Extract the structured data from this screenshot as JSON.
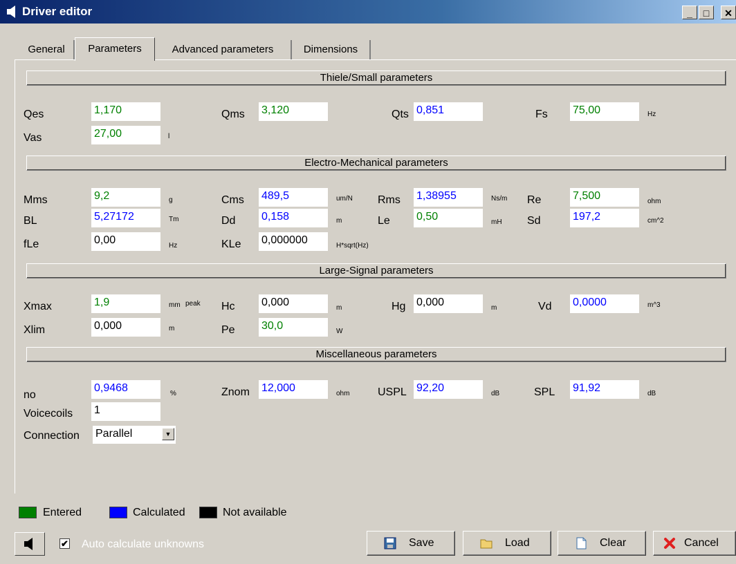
{
  "window": {
    "title": "Driver editor"
  },
  "tabs": [
    "General",
    "Parameters",
    "Advanced parameters",
    "Dimensions"
  ],
  "sections": {
    "ts": "Thiele/Small parameters",
    "em": "Electro-Mechanical parameters",
    "ls": "Large-Signal parameters",
    "misc": "Miscellaneous parameters"
  },
  "params": {
    "qes": {
      "label": "Qes",
      "value": "1,170",
      "unit": ""
    },
    "qms": {
      "label": "Qms",
      "value": "3,120",
      "unit": ""
    },
    "qts": {
      "label": "Qts",
      "value": "0,851",
      "unit": ""
    },
    "fs": {
      "label": "Fs",
      "value": "75,00",
      "unit": "Hz"
    },
    "vas": {
      "label": "Vas",
      "value": "27,00",
      "unit": "l"
    },
    "mms": {
      "label": "Mms",
      "value": "9,2",
      "unit": "g"
    },
    "cms": {
      "label": "Cms",
      "value": "489,5",
      "unit": "um/N"
    },
    "rms": {
      "label": "Rms",
      "value": "1,38955",
      "unit": "Ns/m"
    },
    "re": {
      "label": "Re",
      "value": "7,500",
      "unit": "ohm"
    },
    "bl": {
      "label": "BL",
      "value": "5,27172",
      "unit": "Tm"
    },
    "dd": {
      "label": "Dd",
      "value": "0,158",
      "unit": "m"
    },
    "le": {
      "label": "Le",
      "value": "0,50",
      "unit": "mH"
    },
    "sd": {
      "label": "Sd",
      "value": "197,2",
      "unit": "cm^2"
    },
    "fle": {
      "label": "fLe",
      "value": "0,00",
      "unit": "Hz"
    },
    "kle": {
      "label": "KLe",
      "value": "0,000000",
      "unit": "H*sqrt(Hz)"
    },
    "xmax": {
      "label": "Xmax",
      "value": "1,9",
      "unit": "mm",
      "unit2": "peak"
    },
    "hc": {
      "label": "Hc",
      "value": "0,000",
      "unit": "m"
    },
    "hg": {
      "label": "Hg",
      "value": "0,000",
      "unit": "m"
    },
    "vd": {
      "label": "Vd",
      "value": "0,0000",
      "unit": "m^3"
    },
    "xlim": {
      "label": "Xlim",
      "value": "0,000",
      "unit": "m"
    },
    "pe": {
      "label": "Pe",
      "value": "30,0",
      "unit": "W"
    },
    "no": {
      "label": "no",
      "value": "0,9468",
      "unit": "%"
    },
    "znom": {
      "label": "Znom",
      "value": "12,000",
      "unit": "ohm"
    },
    "uspl": {
      "label": "USPL",
      "value": "92,20",
      "unit": "dB"
    },
    "spl": {
      "label": "SPL",
      "value": "91,92",
      "unit": "dB"
    },
    "voicecoils": {
      "label": "Voicecoils",
      "value": "1"
    },
    "connection": {
      "label": "Connection",
      "value": "Parallel"
    }
  },
  "legend": {
    "entered": "Entered",
    "calculated": "Calculated",
    "not_available": "Not available",
    "colors": {
      "entered": "#008000",
      "calculated": "#0000ff",
      "not_available": "#000000"
    }
  },
  "bottom": {
    "auto_calc": "Auto calculate unknowns",
    "auto_calc_checked": true,
    "save": "Save",
    "load": "Load",
    "clear": "Clear",
    "cancel": "Cancel"
  }
}
